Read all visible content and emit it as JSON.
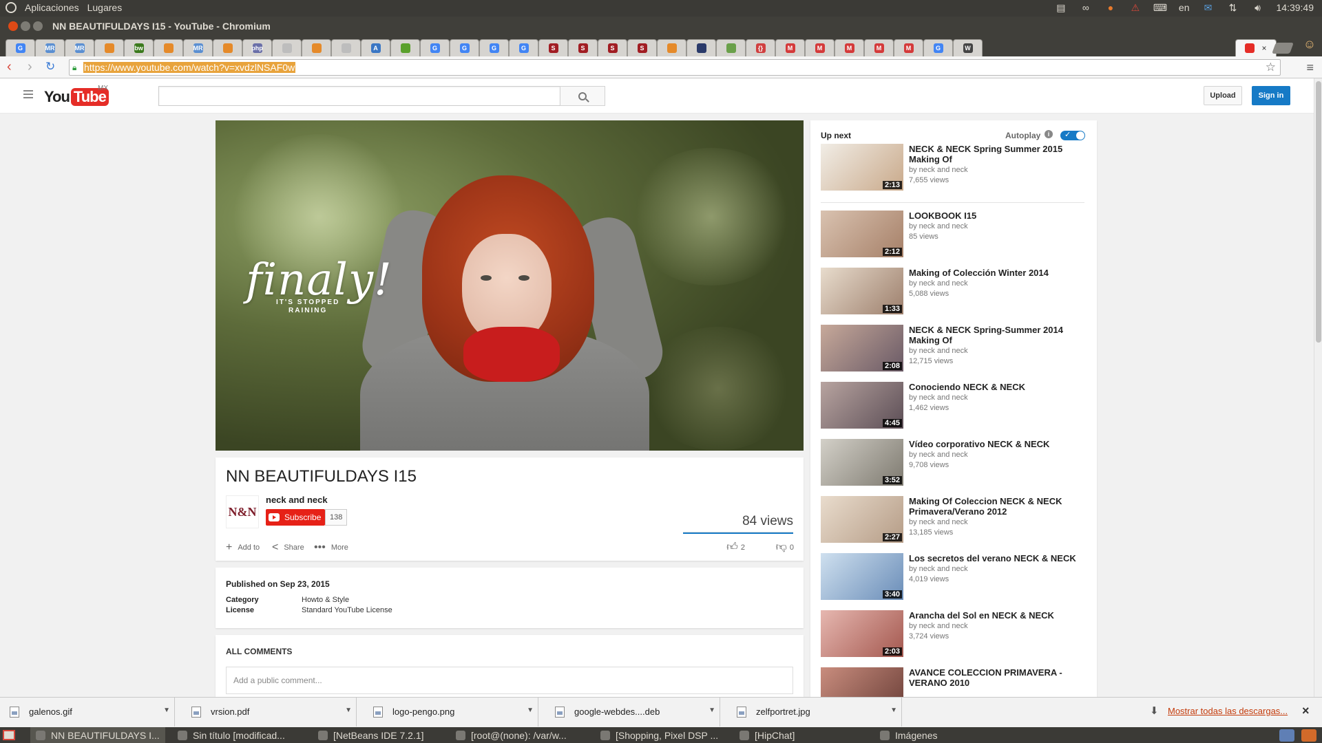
{
  "os_panel": {
    "applications": "Aplicaciones",
    "places": "Lugares",
    "language": "en",
    "clock": "14:39:49"
  },
  "window": {
    "title": "NN BEAUTIFULDAYS I15 - YouTube - Chromium"
  },
  "tabs": [
    {
      "icon": "google-icon",
      "label": "G",
      "color": "#4285f4"
    },
    {
      "icon": "mr-icon",
      "label": "MR",
      "color": "#5b8fd1"
    },
    {
      "icon": "mr-icon",
      "label": "MR",
      "color": "#5b8fd1"
    },
    {
      "icon": "orange-icon",
      "label": "",
      "color": "#e58a2a"
    },
    {
      "icon": "bw-icon",
      "label": "bw",
      "color": "#3c7a1e"
    },
    {
      "icon": "orange-icon",
      "label": "",
      "color": "#e58a2a"
    },
    {
      "icon": "mr-icon",
      "label": "MR",
      "color": "#5b8fd1"
    },
    {
      "icon": "orange-icon",
      "label": "",
      "color": "#e58a2a"
    },
    {
      "icon": "php-icon",
      "label": "php",
      "color": "#6a6fa8"
    },
    {
      "icon": "doc-icon",
      "label": "",
      "color": "#bdbdbd"
    },
    {
      "icon": "orange-icon",
      "label": "",
      "color": "#e58a2a"
    },
    {
      "icon": "doc-icon",
      "label": "",
      "color": "#bdbdbd"
    },
    {
      "icon": "adwords-icon",
      "label": "A",
      "color": "#3a76c4"
    },
    {
      "icon": "green-icon",
      "label": "",
      "color": "#5aa02c"
    },
    {
      "icon": "google-icon",
      "label": "G",
      "color": "#4285f4"
    },
    {
      "icon": "google-icon",
      "label": "G",
      "color": "#4285f4"
    },
    {
      "icon": "google-icon",
      "label": "G",
      "color": "#4285f4"
    },
    {
      "icon": "google-icon",
      "label": "G",
      "color": "#4285f4"
    },
    {
      "icon": "s-icon",
      "label": "S",
      "color": "#a11d23"
    },
    {
      "icon": "s-icon",
      "label": "S",
      "color": "#a11d23"
    },
    {
      "icon": "s-icon",
      "label": "S",
      "color": "#a11d23"
    },
    {
      "icon": "s-icon",
      "label": "S",
      "color": "#a11d23"
    },
    {
      "icon": "orange-icon",
      "label": "",
      "color": "#e58a2a"
    },
    {
      "icon": "dark-icon",
      "label": "",
      "color": "#2a3a6a"
    },
    {
      "icon": "grid-icon",
      "label": "",
      "color": "#6aa04a"
    },
    {
      "icon": "brackets-icon",
      "label": "{}",
      "color": "#d04040"
    },
    {
      "icon": "m-icon",
      "label": "M",
      "color": "#d43a3a"
    },
    {
      "icon": "m-icon",
      "label": "M",
      "color": "#d43a3a"
    },
    {
      "icon": "m-icon",
      "label": "M",
      "color": "#d43a3a"
    },
    {
      "icon": "m-icon",
      "label": "M",
      "color": "#d43a3a"
    },
    {
      "icon": "m-icon",
      "label": "M",
      "color": "#d43a3a"
    },
    {
      "icon": "google-icon",
      "label": "G",
      "color": "#4285f4"
    },
    {
      "icon": "wikipedia-icon",
      "label": "W",
      "color": "#444444"
    }
  ],
  "active_tab": {
    "icon": "youtube-icon",
    "close": "×"
  },
  "omnibox": {
    "url": "https://www.youtube.com/watch?v=xvdzlNSAF0w"
  },
  "yt_header": {
    "logo_you": "You",
    "logo_tube": "Tube",
    "region": "MX",
    "search_placeholder": "",
    "upload": "Upload",
    "sign_in": "Sign in"
  },
  "player": {
    "overlay_script": "finaly!",
    "overlay_sub_line1": "IT'S STOPPED",
    "overlay_sub_line2": "RAINING"
  },
  "video": {
    "title": "NN BEAUTIFULDAYS I15",
    "channel": "neck and neck",
    "avatar_text": "N&N",
    "subscribe": "Subscribe",
    "subscribers": "138",
    "views": "84 views",
    "add_to": "Add to",
    "share": "Share",
    "more": "More",
    "likes": "2",
    "dislikes": "0"
  },
  "description": {
    "published": "Published on Sep 23, 2015",
    "category_label": "Category",
    "category_value": "Howto & Style",
    "license_label": "License",
    "license_value": "Standard YouTube License"
  },
  "comments": {
    "title": "ALL COMMENTS",
    "placeholder": "Add a public comment..."
  },
  "sidebar": {
    "up_next": "Up next",
    "autoplay": "Autoplay",
    "autoplay_on": true,
    "items": [
      {
        "title": "NECK & NECK Spring Summer 2015 Making Of",
        "channel": "by neck and neck",
        "views": "7,655 views",
        "duration": "2:13"
      },
      {
        "title": "LOOKBOOK I15",
        "channel": "by neck and neck",
        "views": "85 views",
        "duration": "2:12"
      },
      {
        "title": "Making of Colección Winter 2014",
        "channel": "by neck and neck",
        "views": "5,088 views",
        "duration": "1:33"
      },
      {
        "title": "NECK & NECK Spring-Summer 2014 Making Of",
        "channel": "by neck and neck",
        "views": "12,715 views",
        "duration": "2:08"
      },
      {
        "title": "Conociendo NECK & NECK",
        "channel": "by neck and neck",
        "views": "1,462 views",
        "duration": "4:45"
      },
      {
        "title": "Vídeo corporativo NECK & NECK",
        "channel": "by neck and neck",
        "views": "9,708 views",
        "duration": "3:52"
      },
      {
        "title": "Making Of Coleccion NECK & NECK Primavera/Verano 2012",
        "channel": "by neck and neck",
        "views": "13,185 views",
        "duration": "2:27"
      },
      {
        "title": "Los secretos del verano NECK & NECK",
        "channel": "by neck and neck",
        "views": "4,019 views",
        "duration": "3:40"
      },
      {
        "title": "Arancha del Sol en NECK & NECK",
        "channel": "by neck and neck",
        "views": "3,724 views",
        "duration": "2:03"
      },
      {
        "title": "AVANCE COLECCION PRIMAVERA - VERANO 2010",
        "channel": "",
        "views": "",
        "duration": ""
      }
    ]
  },
  "downloads": {
    "items": [
      {
        "name": "galenos.gif"
      },
      {
        "name": "vrsion.pdf"
      },
      {
        "name": "logo-pengo.png"
      },
      {
        "name": "google-webdes....deb"
      },
      {
        "name": "zelfportret.jpg"
      }
    ],
    "show_all": "Mostrar todas las descargas..."
  },
  "taskbar": {
    "items": [
      {
        "label": "NN BEAUTIFULDAYS I..."
      },
      {
        "label": "Sin título [modificad..."
      },
      {
        "label": "[NetBeans IDE 7.2.1]"
      },
      {
        "label": "[root@(none): /var/w..."
      },
      {
        "label": "[Shopping, Pixel DSP ..."
      },
      {
        "label": "[HipChat]"
      },
      {
        "label": "Imágenes"
      }
    ]
  },
  "colors": {
    "yt_red": "#e52d27",
    "yt_blue": "#167ac6",
    "download_link": "#c43b0b"
  }
}
